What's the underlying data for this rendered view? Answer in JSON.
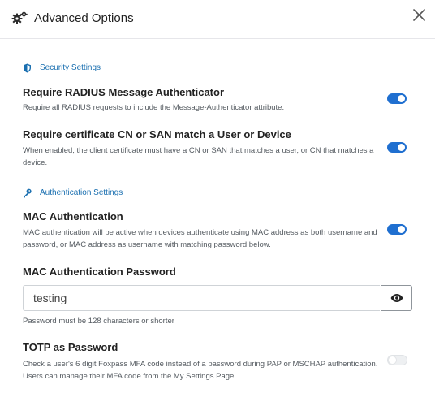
{
  "dialog": {
    "title": "Advanced Options",
    "icon": "gears-icon",
    "close_icon": "close-icon"
  },
  "sections": {
    "security": {
      "label": "Security Settings",
      "icon": "shield-icon"
    },
    "authentication": {
      "label": "Authentication Settings",
      "icon": "key-icon"
    }
  },
  "settings": {
    "radius_authenticator": {
      "title": "Require RADIUS Message Authenticator",
      "description": "Require all RADIUS requests to include the Message-Authenticator attribute.",
      "enabled": true
    },
    "cert_match": {
      "title": "Require certificate CN or SAN match a User or Device",
      "description": "When enabled, the client certificate must have a CN or SAN that matches a user, or CN that matches a device.",
      "enabled": true
    },
    "mac_auth": {
      "title": "MAC Authentication",
      "description": "MAC authentication will be active when devices authenticate using MAC address as both username and password, or MAC address as username with matching password below.",
      "enabled": true
    },
    "mac_password": {
      "title": "MAC Authentication Password",
      "value": "testing",
      "hint": "Password must be 128 characters or shorter",
      "reveal_icon": "eye-icon"
    },
    "totp": {
      "title": "TOTP as Password",
      "description": "Check a user's 6 digit Foxpass MFA code instead of a password during PAP or MSCHAP authentication. Users can manage their MFA code from the My Settings Page.",
      "enabled": false
    }
  },
  "colors": {
    "accent": "#1f6fd0",
    "section_label": "#1a6fb0"
  }
}
